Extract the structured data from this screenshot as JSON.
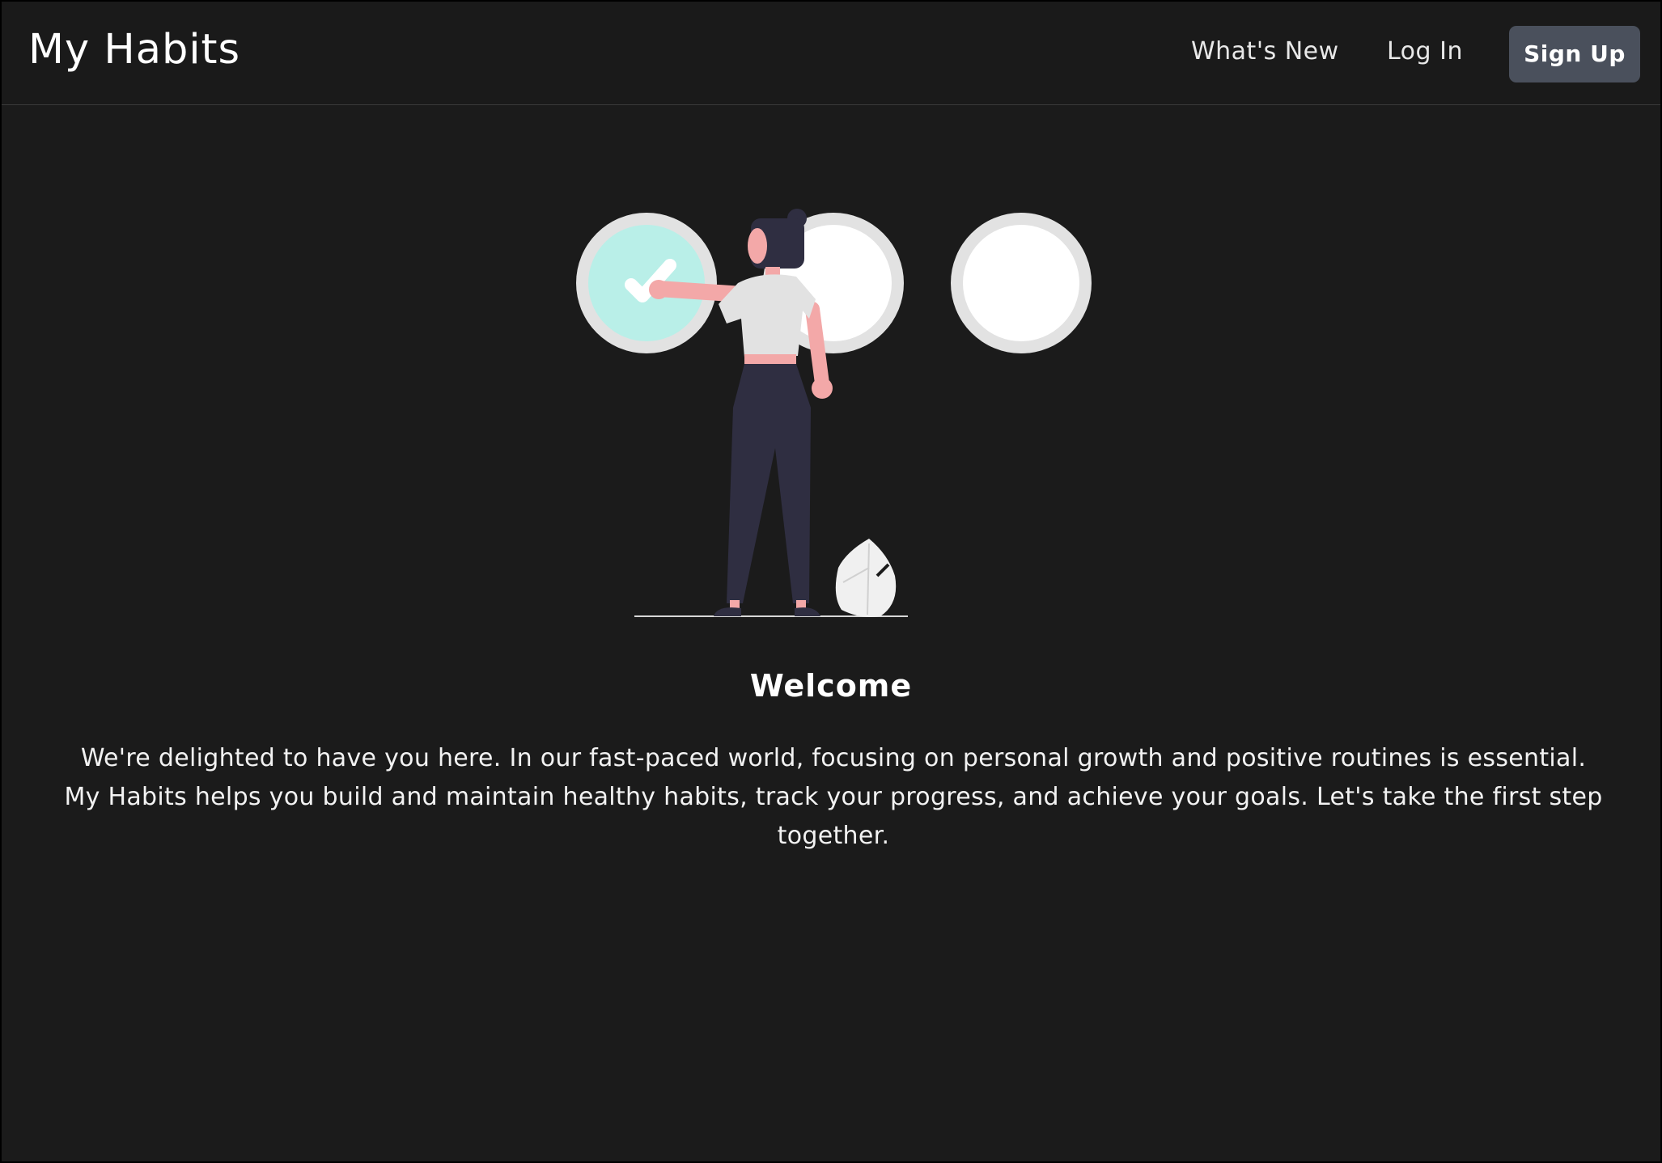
{
  "navbar": {
    "brand": "My Habits",
    "links": {
      "whats_new": "What's New",
      "log_in": "Log In"
    },
    "signup_label": "Sign Up"
  },
  "hero": {
    "title": "Welcome",
    "description": "We're delighted to have you here. In our fast-paced world, focusing on personal growth and positive routines is essential. My Habits helps you build and maintain healthy habits, track your progress, and achieve your goals. Let's take the first step together."
  },
  "colors": {
    "background": "#1b1b1b",
    "signup_button": "#4a505c",
    "checked_circle": "#b9efe8",
    "circle_ring": "#e2e2e2",
    "figure_dark": "#2f2e41",
    "skin": "#f3a8a8"
  },
  "illustration": {
    "circles_total": 3,
    "circles_checked": 1,
    "icons": [
      "check-icon",
      "person-figure",
      "leaf-plant-icon"
    ]
  }
}
